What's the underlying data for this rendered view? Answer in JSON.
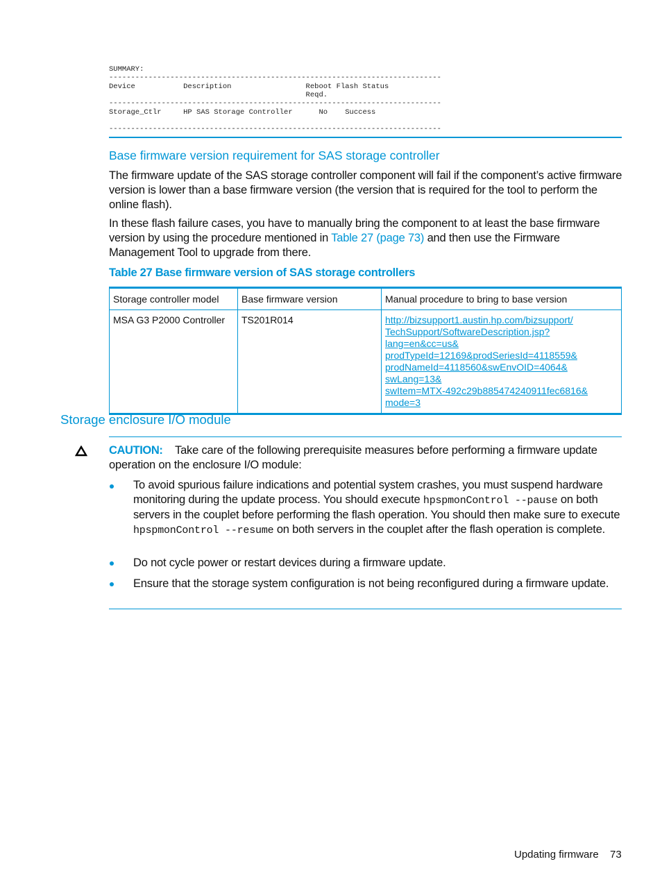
{
  "summary_block": {
    "title": "SUMMARY:",
    "dashes": "----------------------------------------------------------------------------",
    "header_line1": "Device           Description                 Reboot Flash Status",
    "header_line2": "                                             Reqd.",
    "row_line": "Storage_Ctlr     HP SAS Storage Controller      No    Success",
    "columns": [
      "Device",
      "Description",
      "Reboot Reqd.",
      "Flash Status"
    ],
    "rows": [
      [
        "Storage_Ctlr",
        "HP SAS Storage Controller",
        "No",
        "Success"
      ]
    ]
  },
  "section1": {
    "heading": "Base firmware version requirement for SAS storage controller",
    "para1": "The firmware update of the SAS storage controller component will fail if the component’s active firmware version is lower than a base firmware version (the version that is required for the tool to perform the online flash).",
    "para2_before": "In these flash failure cases, you have to manually bring the component to at least the base firmware version by using the procedure mentioned in ",
    "para2_link": "Table 27 (page 73)",
    "para2_after": " and then use the Firmware Management Tool to upgrade from there."
  },
  "table27": {
    "title": "Table 27 Base firmware version of SAS storage controllers",
    "headers": [
      "Storage controller model",
      "Base firmware version",
      "Manual procedure to bring to base version"
    ],
    "rows": [
      {
        "model": "MSA G3 P2000 Controller",
        "version": "TS201R014",
        "link_lines": [
          "http://bizsupport1.austin.hp.com/bizsupport/",
          "TechSupport/SoftwareDescription.jsp?lang=en&cc=us&",
          "prodTypeId=12169&prodSeriesId=4118559&",
          "prodNameId=4118560&swEnvOID=4064&",
          "swLang=13&",
          "swItem=MTX-492c29b885474240911fec6816&",
          "mode=3"
        ]
      }
    ]
  },
  "section2": {
    "heading": "Storage enclosure I/O module",
    "caution_icon": "warning-triangle-icon",
    "caution_label": "CAUTION:",
    "caution_text": "Take care of the following prerequisite measures before performing a firmware update operation on the enclosure I/O module:",
    "bullets": [
      {
        "part1": "To avoid spurious failure indications and potential system crashes, you must suspend hardware monitoring during the update process. You should execute ",
        "code1": "hpspmonControl --pause",
        "part2": " on both servers in the couplet before performing the flash operation. You should then make sure to execute ",
        "code2": "hpspmonControl --resume",
        "part3": " on both servers in the couplet after the flash operation is complete."
      },
      {
        "text": "Do not cycle power or restart devices during a firmware update."
      },
      {
        "text": "Ensure that the storage system configuration is not being reconfigured during a firmware update."
      }
    ]
  },
  "footer": {
    "section": "Updating firmware",
    "page_number": "73"
  },
  "colors": {
    "accent": "#0096d6",
    "text": "#111111"
  }
}
